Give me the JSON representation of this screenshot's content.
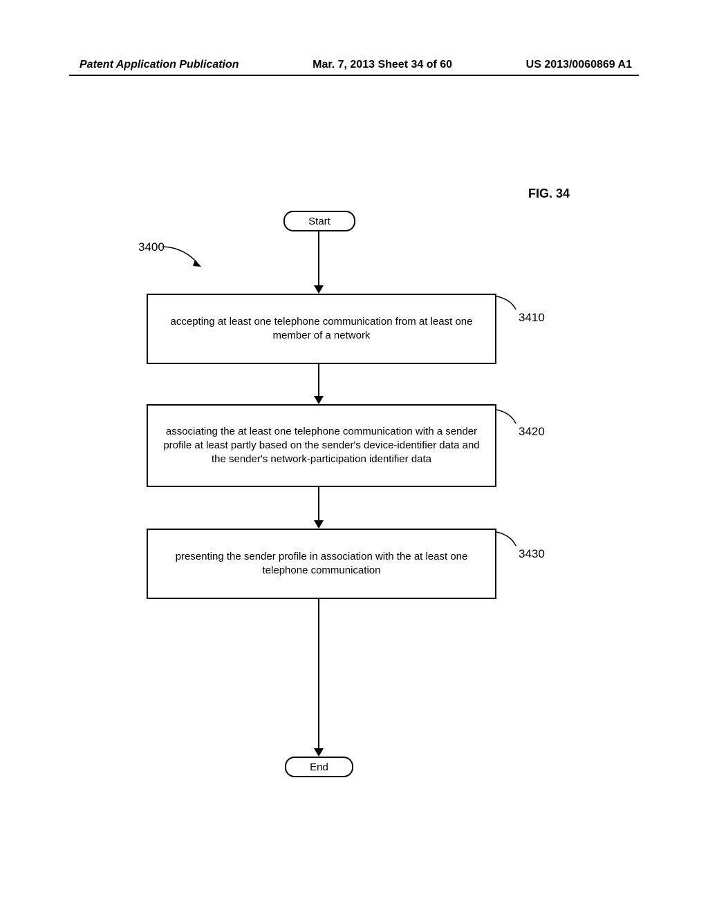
{
  "header": {
    "left": "Patent Application Publication",
    "center": "Mar. 7, 2013  Sheet 34 of 60",
    "right": "US 2013/0060869 A1"
  },
  "figure_label": "FIG. 34",
  "terminators": {
    "start": "Start",
    "end": "End"
  },
  "refs": {
    "r3400": "3400",
    "r3410": "3410",
    "r3420": "3420",
    "r3430": "3430"
  },
  "steps": {
    "s3410": "accepting at least one telephone communication from at least one member of a network",
    "s3420": "associating the at least one telephone communication with a sender profile at least partly based on the sender's device-identifier data and the sender's network-participation identifier data",
    "s3430": "presenting the sender profile in association with the at least one telephone communication"
  },
  "chart_data": {
    "type": "flowchart",
    "title": "FIG. 34",
    "reference": "3400",
    "nodes": [
      {
        "id": "start",
        "type": "terminator",
        "label": "Start"
      },
      {
        "id": "3410",
        "type": "process",
        "label": "accepting at least one telephone communication from at least one member of a network"
      },
      {
        "id": "3420",
        "type": "process",
        "label": "associating the at least one telephone communication with a sender profile at least partly based on the sender's device-identifier data and the sender's network-participation identifier data"
      },
      {
        "id": "3430",
        "type": "process",
        "label": "presenting the sender profile in association with the at least one telephone communication"
      },
      {
        "id": "end",
        "type": "terminator",
        "label": "End"
      }
    ],
    "edges": [
      {
        "from": "start",
        "to": "3410"
      },
      {
        "from": "3410",
        "to": "3420"
      },
      {
        "from": "3420",
        "to": "3430"
      },
      {
        "from": "3430",
        "to": "end"
      }
    ]
  }
}
